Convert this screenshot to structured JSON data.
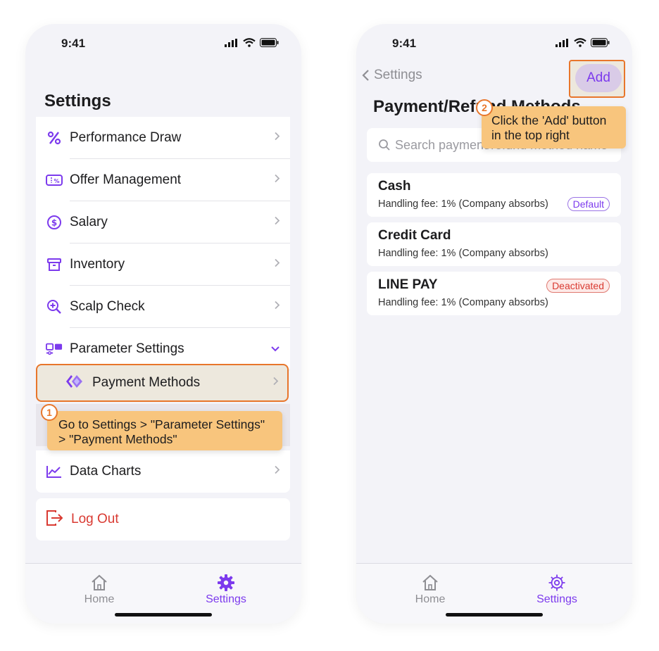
{
  "status": {
    "time": "9:41"
  },
  "left": {
    "title": "Settings",
    "items": [
      {
        "label": "Performance Draw",
        "icon": "percent-icon"
      },
      {
        "label": "Offer Management",
        "icon": "coupon-icon"
      },
      {
        "label": "Salary",
        "icon": "dollar-circle-icon"
      },
      {
        "label": "Inventory",
        "icon": "archive-box-icon"
      },
      {
        "label": "Scalp Check",
        "icon": "magnify-plus-icon"
      },
      {
        "label": "Parameter Settings",
        "icon": "parameters-icon"
      }
    ],
    "payment_methods": "Payment Methods",
    "data_charts": "Data Charts",
    "log_out": "Log Out",
    "tooltip_step": "1",
    "tooltip_text_1": "Go to Settings > \"Parameter Settings\"",
    "tooltip_text_2": "> \"Payment Methods\""
  },
  "right": {
    "back_label": "Settings",
    "add_label": "Add",
    "title": "Payment/Refund Methods",
    "search_placeholder": "Search payment/refund method name",
    "tooltip_step": "2",
    "tooltip_text_1": "Click the 'Add' button",
    "tooltip_text_2": "in the top right",
    "methods": [
      {
        "name": "Cash",
        "fee": "Handling fee: 1% (Company absorbs)",
        "badge": "Default"
      },
      {
        "name": "Credit Card",
        "fee": "Handling fee: 1% (Company absorbs)",
        "badge": ""
      },
      {
        "name": "LINE PAY",
        "fee": "Handling fee: 1% (Company absorbs)",
        "badge": "Deactivated"
      }
    ]
  },
  "tabbar": {
    "home": "Home",
    "settings": "Settings"
  },
  "colors": {
    "accent": "#7c3aed",
    "highlight": "#e8762b",
    "tooltip": "#f8c57d",
    "danger": "#d93a32"
  }
}
